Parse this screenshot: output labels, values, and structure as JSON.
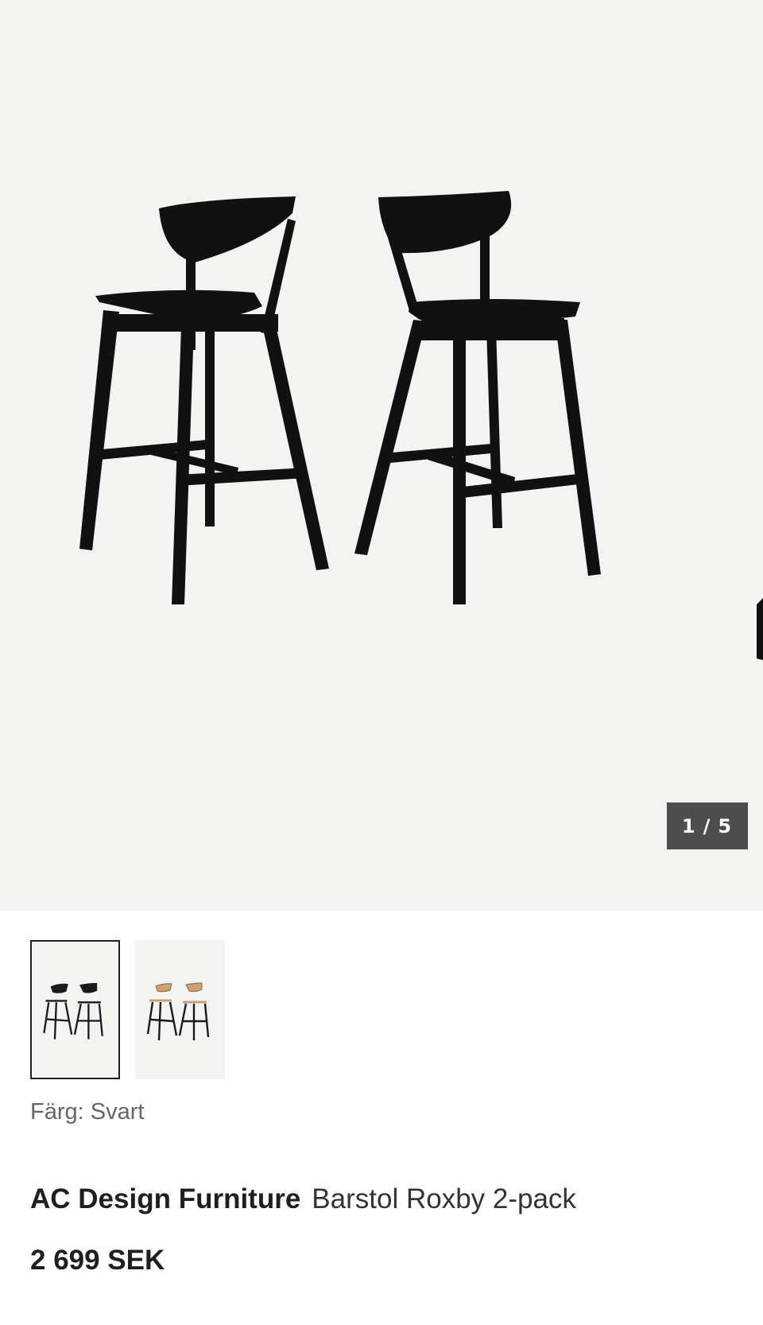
{
  "gallery": {
    "current_image": "1",
    "total_images": "5",
    "counter_separator": "/",
    "hero_icon": "black-bar-stools-pair-image",
    "background_color": "#f3f3f1"
  },
  "thumbnails": [
    {
      "color": "black",
      "icon": "black-bar-stools-thumbnail",
      "selected": true
    },
    {
      "color": "oak",
      "icon": "oak-bar-stools-thumbnail",
      "selected": false
    }
  ],
  "color_selector": {
    "label": "Färg: Svart"
  },
  "product": {
    "brand": "AC Design Furniture",
    "name": "Barstol Roxby 2-pack",
    "price": "2 699 SEK"
  },
  "colors": {
    "counter_bg": "#4d4d4d",
    "text_primary": "#1f1f1f",
    "text_muted": "#666666"
  }
}
